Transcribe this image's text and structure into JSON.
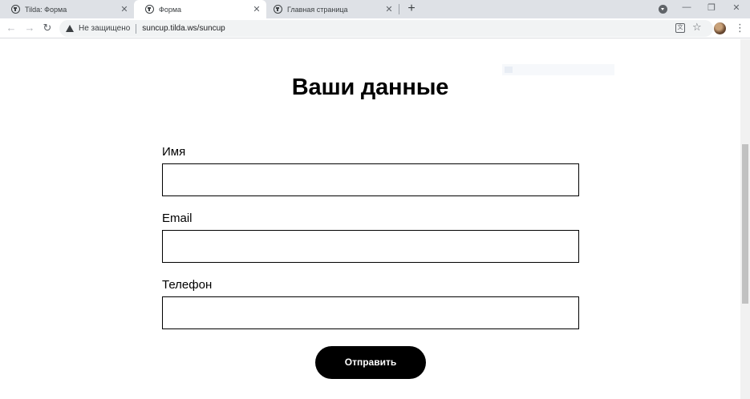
{
  "browser": {
    "tabs": [
      {
        "title": "Tilda: Форма",
        "close": "✕"
      },
      {
        "title": "Форма",
        "close": "✕"
      },
      {
        "title": "Главная страница",
        "close": "✕"
      }
    ],
    "new_tab": "+",
    "window": {
      "minimize": "—",
      "restore": "❐",
      "close": "✕"
    },
    "nav": {
      "back": "←",
      "forward": "→",
      "reload": "↻"
    },
    "security_label": "Не защищено",
    "url": "suncup.tilda.ws/suncup",
    "translate_icon": "文",
    "star": "☆",
    "menu": "⋮"
  },
  "form": {
    "title": "Ваши данные",
    "fields": [
      {
        "label": "Имя",
        "value": ""
      },
      {
        "label": "Email",
        "value": ""
      },
      {
        "label": "Телефон",
        "value": ""
      }
    ],
    "submit_label": "Отправить"
  }
}
